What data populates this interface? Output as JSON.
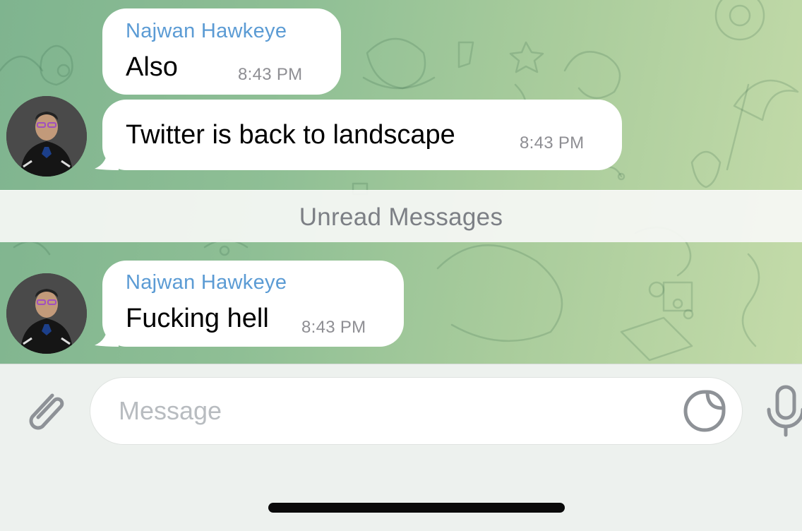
{
  "messages": [
    {
      "sender": "Najwan Hawkeye",
      "text": "Also",
      "time": "8:43 PM"
    },
    {
      "sender": "",
      "text": "Twitter is back to landscape",
      "time": "8:43 PM"
    },
    {
      "sender": "Najwan Hawkeye",
      "text": "Fucking hell",
      "time": "8:43 PM"
    }
  ],
  "divider": {
    "label": "Unread Messages"
  },
  "composer": {
    "placeholder": "Message",
    "attach_icon": "paperclip-icon",
    "sticker_icon": "sticker-icon",
    "mic_icon": "microphone-icon"
  },
  "colors": {
    "sender_name": "#5b9bd4",
    "bubble": "#ffffff",
    "wallpaper_left": "#7fb48f",
    "wallpaper_right": "#c4dba9",
    "time": "#8e8e93"
  }
}
